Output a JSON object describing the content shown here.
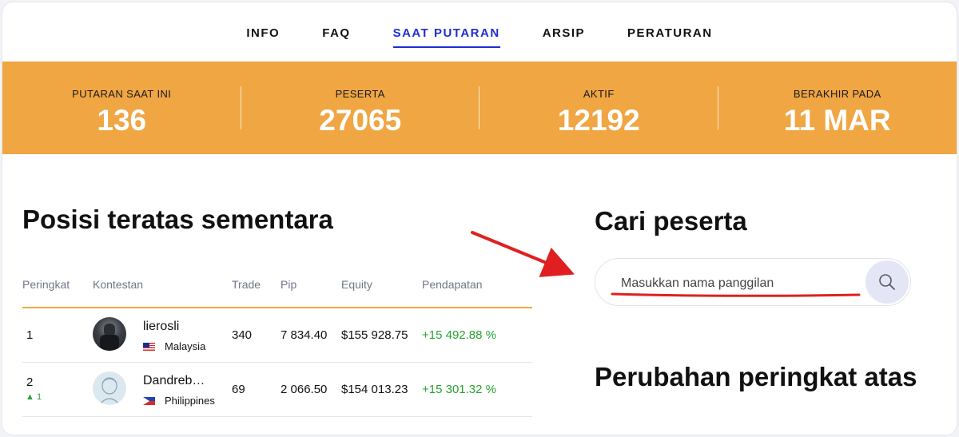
{
  "nav": {
    "items": [
      {
        "label": "INFO"
      },
      {
        "label": "FAQ"
      },
      {
        "label": "SAAT PUTARAN",
        "active": true
      },
      {
        "label": "ARSIP"
      },
      {
        "label": "PERATURAN"
      }
    ]
  },
  "stats": [
    {
      "label": "PUTARAN SAAT INI",
      "value": "136"
    },
    {
      "label": "PESERTA",
      "value": "27065"
    },
    {
      "label": "AKTIF",
      "value": "12192"
    },
    {
      "label": "BERAKHIR PADA",
      "value": "11 MAR"
    }
  ],
  "leaderboard": {
    "title": "Posisi teratas sementara",
    "columns": [
      "Peringkat",
      "Kontestan",
      "Trade",
      "Pip",
      "Equity",
      "Pendapatan"
    ],
    "rows": [
      {
        "rank": "1",
        "change": "",
        "name": "lierosli",
        "country": "Malaysia",
        "trade": "340",
        "pip": "7 834.40",
        "equity": "$155 928.75",
        "gain": "+15 492.88 %"
      },
      {
        "rank": "2",
        "change": "▲ 1",
        "name": "Dandreb…",
        "country": "Philippines",
        "trade": "69",
        "pip": "2 066.50",
        "equity": "$154 013.23",
        "gain": "+15 301.32 %"
      }
    ]
  },
  "search": {
    "title": "Cari peserta",
    "placeholder": "Masukkan nama panggilan",
    "icon": "search-icon"
  },
  "rank_changes": {
    "title": "Perubahan peringkat atas"
  },
  "colors": {
    "accent": "#f0a643",
    "nav_active": "#1d2fcf",
    "gain": "#27a22f",
    "annotation": "#e02020"
  }
}
